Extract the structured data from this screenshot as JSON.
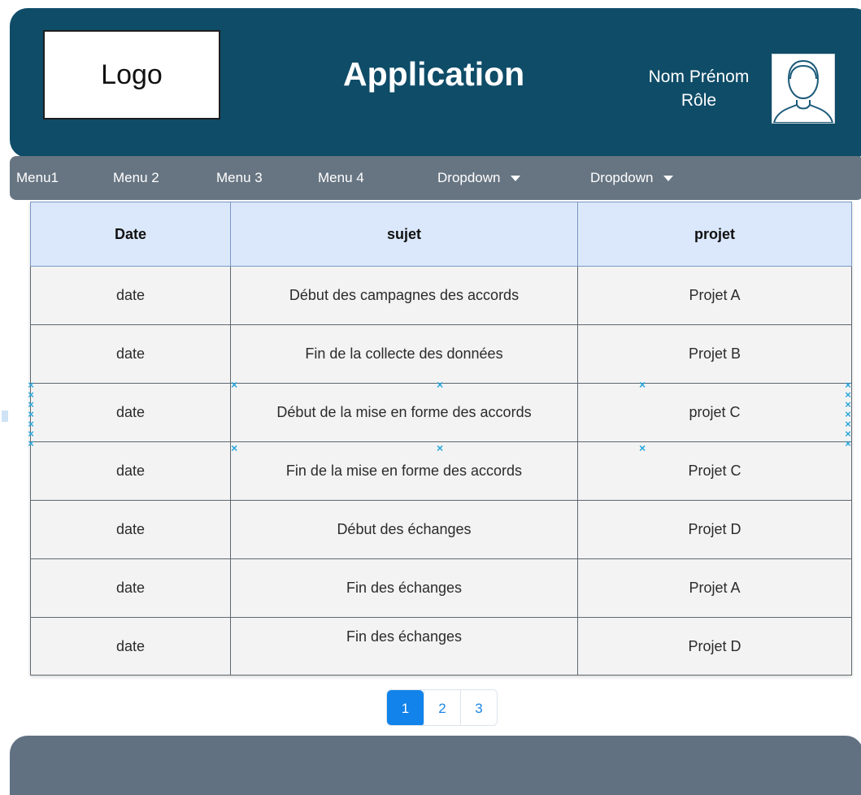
{
  "header": {
    "logo_label": "Logo",
    "title": "Application",
    "user_name": "Nom Prénom",
    "user_role": "Rôle",
    "avatar_icon": "user-avatar-icon"
  },
  "nav": {
    "items": [
      {
        "label": "Menu1"
      },
      {
        "label": "Menu 2"
      },
      {
        "label": "Menu 3"
      },
      {
        "label": "Menu 4"
      },
      {
        "label": "Dropdown"
      },
      {
        "label": "Dropdown"
      }
    ]
  },
  "table": {
    "columns": [
      "Date",
      "sujet",
      "projet"
    ],
    "rows": [
      {
        "date": "date",
        "sujet": "Début des campagnes des accords",
        "projet": "Projet A"
      },
      {
        "date": "date",
        "sujet": "Fin de la collecte des données",
        "projet": "Projet B"
      },
      {
        "date": "date",
        "sujet": "Début de la mise en forme des accords",
        "projet": "projet C"
      },
      {
        "date": "date",
        "sujet": "Fin de la mise en forme des accords",
        "projet": "Projet C"
      },
      {
        "date": "date",
        "sujet": "Début des échanges",
        "projet": "Projet D"
      },
      {
        "date": "date",
        "sujet": "Fin des échanges",
        "projet": "Projet A"
      },
      {
        "date": "date",
        "sujet": "Fin des échanges",
        "projet": "Projet D"
      }
    ]
  },
  "pagination": {
    "pages": [
      "1",
      "2",
      "3"
    ],
    "active": "1"
  },
  "colors": {
    "header_bg": "#0f4c68",
    "nav_bg": "#677582",
    "table_header_bg": "#dbe8fb",
    "cell_bg": "#f3f3f3",
    "accent": "#1183ea",
    "footer_bg": "#617182"
  }
}
